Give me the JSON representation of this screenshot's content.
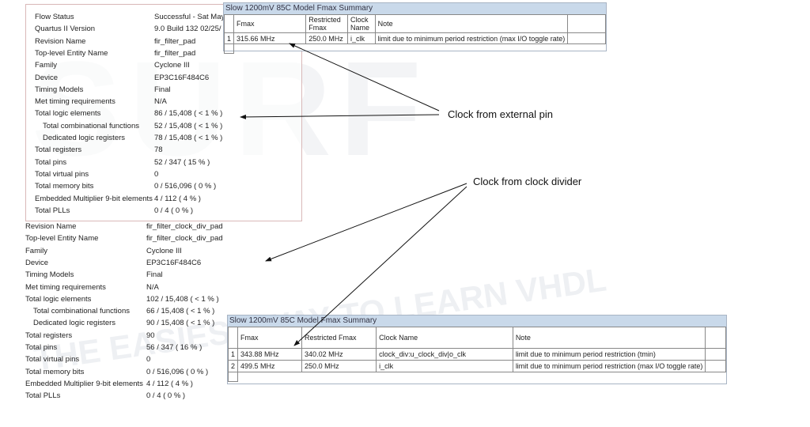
{
  "watermark": {
    "line1": "SURF VHDL",
    "line2": "THE EASIEST WAY TO LEARN VHDL"
  },
  "top_summary": [
    [
      "Flow Status",
      "Successful - Sat May"
    ],
    [
      "Quartus II Version",
      "9.0 Build 132 02/25/"
    ],
    [
      "Revision Name",
      "fir_filter_pad"
    ],
    [
      "Top-level Entity Name",
      "fir_filter_pad"
    ],
    [
      "Family",
      "Cyclone III"
    ],
    [
      "Device",
      "EP3C16F484C6"
    ],
    [
      "Timing Models",
      "Final"
    ],
    [
      "Met timing requirements",
      "N/A"
    ],
    [
      "Total logic elements",
      "86 / 15,408 ( < 1 % )"
    ],
    [
      "Total combinational functions",
      "52 / 15,408 ( < 1 % )"
    ],
    [
      "Dedicated logic registers",
      "78 / 15,408 ( < 1 % )"
    ],
    [
      "Total registers",
      "78"
    ],
    [
      "Total pins",
      "52 / 347 ( 15 % )"
    ],
    [
      "Total virtual pins",
      "0"
    ],
    [
      "Total memory bits",
      "0 / 516,096 ( 0 % )"
    ],
    [
      "Embedded Multiplier 9-bit elements",
      "4 / 112 ( 4 % )"
    ],
    [
      "Total PLLs",
      "0 / 4 ( 0 % )"
    ]
  ],
  "bottom_summary": [
    [
      "Revision Name",
      "fir_filter_clock_div_pad"
    ],
    [
      "Top-level Entity Name",
      "fir_filter_clock_div_pad"
    ],
    [
      "Family",
      "Cyclone III"
    ],
    [
      "Device",
      "EP3C16F484C6"
    ],
    [
      "Timing Models",
      "Final"
    ],
    [
      "Met timing requirements",
      "N/A"
    ],
    [
      "Total logic elements",
      "102 / 15,408 ( < 1 % )"
    ],
    [
      "Total combinational functions",
      "66 / 15,408 ( < 1 % )"
    ],
    [
      "Dedicated logic registers",
      "90 / 15,408 ( < 1 % )"
    ],
    [
      "Total registers",
      "90"
    ],
    [
      "Total pins",
      "56 / 347 ( 16 % )"
    ],
    [
      "Total virtual pins",
      "0"
    ],
    [
      "Total memory bits",
      "0 / 516,096 ( 0 % )"
    ],
    [
      "Embedded Multiplier 9-bit elements",
      "4 / 112 ( 4 % )"
    ],
    [
      "Total PLLs",
      "0 / 4 ( 0 % )"
    ]
  ],
  "top_table": {
    "title": "Slow 1200mV 85C Model Fmax Summary",
    "headers": [
      "",
      "Fmax",
      "Restricted Fmax",
      "Clock Name",
      "Note",
      ""
    ],
    "rows": [
      [
        "1",
        "315.66 MHz",
        "250.0 MHz",
        "i_clk",
        "limit due to minimum period restriction (max I/O toggle rate)",
        ""
      ]
    ]
  },
  "bottom_table": {
    "title": "Slow 1200mV 85C Model Fmax Summary",
    "headers": [
      "",
      "Fmax",
      "Restricted Fmax",
      "Clock Name",
      "Note",
      ""
    ],
    "rows": [
      [
        "1",
        "343.88 MHz",
        "340.02 MHz",
        "clock_div:u_clock_div|o_clk",
        "limit due to minimum period restriction (tmin)",
        ""
      ],
      [
        "2",
        "499.5 MHz",
        "250.0 MHz",
        "i_clk",
        "limit due to minimum period restriction (max I/O toggle rate)",
        ""
      ]
    ]
  },
  "annotations": {
    "external": "Clock from external pin",
    "divider": "Clock from clock divider"
  }
}
